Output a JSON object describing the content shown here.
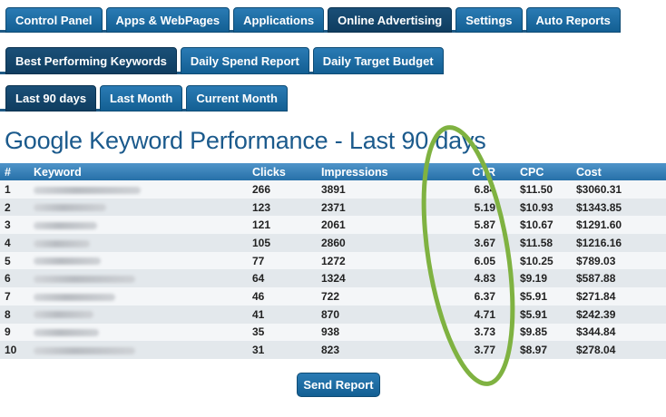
{
  "nav": {
    "main_tabs": [
      "Control Panel",
      "Apps & WebPages",
      "Applications",
      "Online Advertising",
      "Settings",
      "Auto Reports"
    ],
    "sub_tabs": [
      "Best Performing Keywords",
      "Daily Spend Report",
      "Daily Target Budget"
    ],
    "period_tabs": [
      "Last 90 days",
      "Last Month",
      "Current Month"
    ]
  },
  "report": {
    "title": "Google Keyword Performance - Last 90 days",
    "columns": [
      "#",
      "Keyword",
      "Clicks",
      "Impressions",
      "CTR",
      "CPC",
      "Cost"
    ],
    "rows": [
      {
        "num": "1",
        "clicks": "266",
        "impressions": "3891",
        "ctr": "6.84",
        "cpc": "$11.50",
        "cost": "$3060.31"
      },
      {
        "num": "2",
        "clicks": "123",
        "impressions": "2371",
        "ctr": "5.19",
        "cpc": "$10.93",
        "cost": "$1343.85"
      },
      {
        "num": "3",
        "clicks": "121",
        "impressions": "2061",
        "ctr": "5.87",
        "cpc": "$10.67",
        "cost": "$1291.60"
      },
      {
        "num": "4",
        "clicks": "105",
        "impressions": "2860",
        "ctr": "3.67",
        "cpc": "$11.58",
        "cost": "$1216.16"
      },
      {
        "num": "5",
        "clicks": "77",
        "impressions": "1272",
        "ctr": "6.05",
        "cpc": "$10.25",
        "cost": "$789.03"
      },
      {
        "num": "6",
        "clicks": "64",
        "impressions": "1324",
        "ctr": "4.83",
        "cpc": "$9.19",
        "cost": "$587.88"
      },
      {
        "num": "7",
        "clicks": "46",
        "impressions": "722",
        "ctr": "6.37",
        "cpc": "$5.91",
        "cost": "$271.84"
      },
      {
        "num": "8",
        "clicks": "41",
        "impressions": "870",
        "ctr": "4.71",
        "cpc": "$5.91",
        "cost": "$242.39"
      },
      {
        "num": "9",
        "clicks": "35",
        "impressions": "938",
        "ctr": "3.73",
        "cpc": "$9.85",
        "cost": "$344.84"
      },
      {
        "num": "10",
        "clicks": "31",
        "impressions": "823",
        "ctr": "3.77",
        "cpc": "$8.97",
        "cost": "$278.04"
      }
    ]
  },
  "actions": {
    "send_label": "Send Report"
  },
  "colors": {
    "tab_blue": "#135f93",
    "title_blue": "#1b5a8c",
    "highlight_ring": "#7fb241"
  }
}
